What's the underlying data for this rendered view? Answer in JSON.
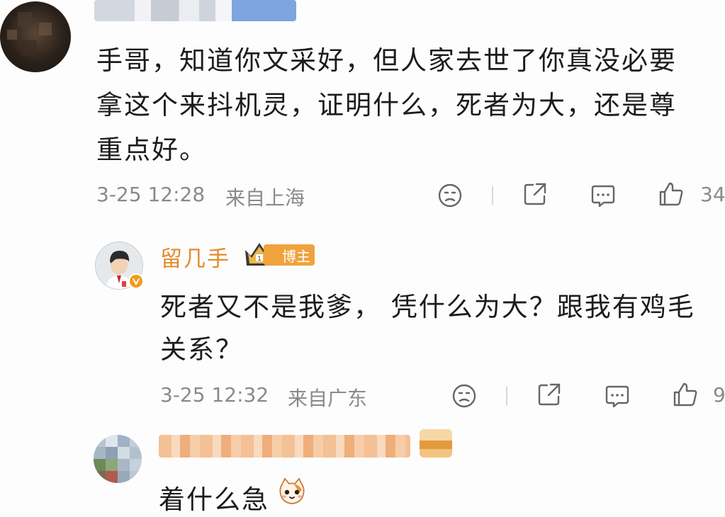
{
  "comment1": {
    "text_line1": "手哥，知道你文采好，但人家去世了你真没必要",
    "text_line2": "拿这个来抖机灵，证明什么，死者为大，还是尊",
    "text_line3": "重点好。",
    "time": "3-25 12:28",
    "location": "来自上海",
    "like_count": "34"
  },
  "reply1": {
    "user_name": "留几手",
    "badge_label": "博主",
    "text_line1": "死者又不是我爹， 凭什么为大？跟我有鸡毛",
    "text_line2": "关系？",
    "time": "3-25 12:32",
    "location": "来自广东",
    "like_count": "9"
  },
  "reply2": {
    "text": "着什么急"
  },
  "colors": {
    "accent_orange": "#e58a2e",
    "badge_orange": "#f0a23c",
    "meta_gray": "#8a8a8a",
    "text_dark": "#1c1c1c"
  },
  "icons": [
    "emoji-face-icon",
    "share-icon",
    "comment-icon",
    "like-icon",
    "verified-icon",
    "crown-icon",
    "cat-emoji-icon"
  ]
}
